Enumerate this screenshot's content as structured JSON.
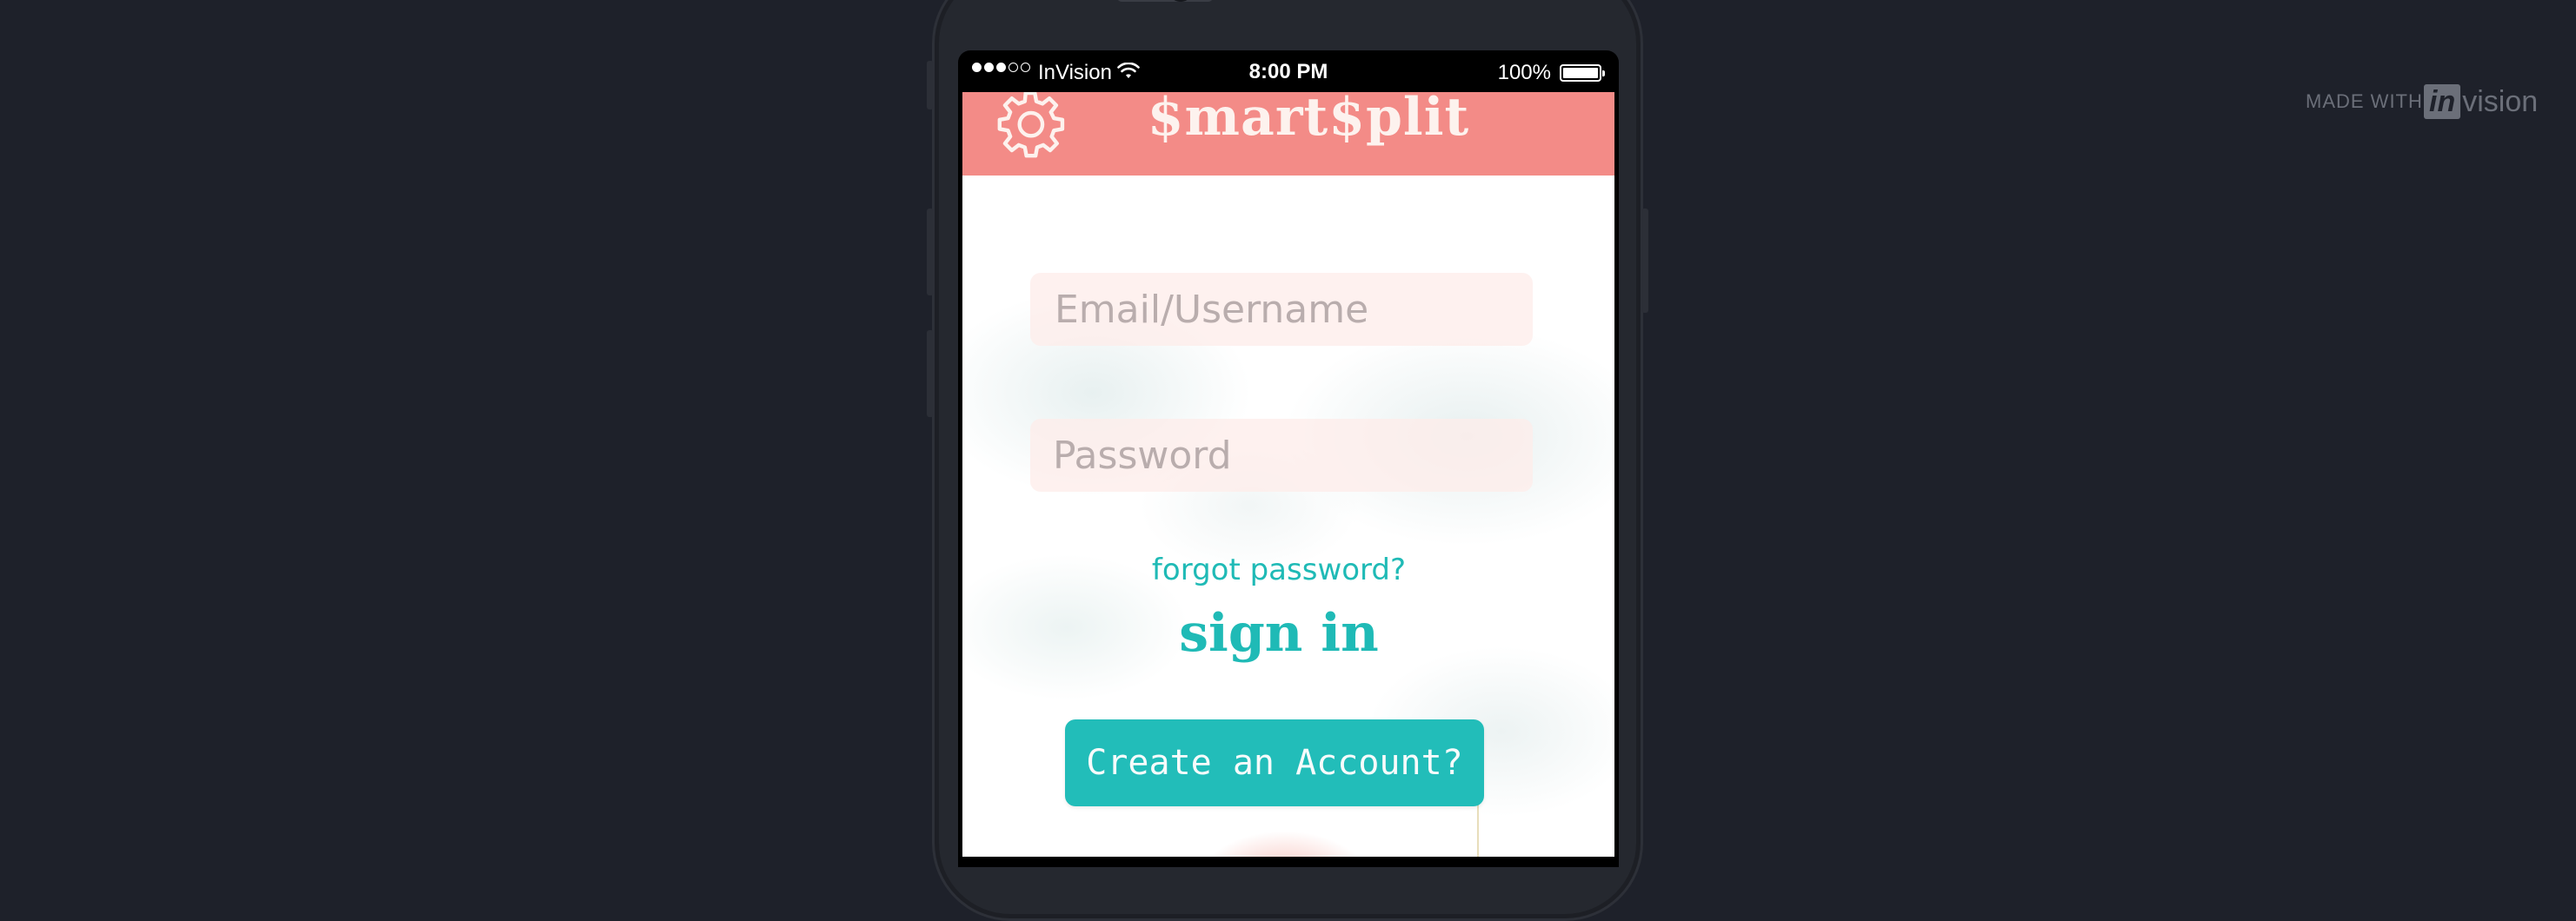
{
  "status_bar": {
    "carrier": "InVision",
    "time": "8:00 PM",
    "battery_pct": "100%",
    "signal_bars_filled": 3,
    "signal_bars_total": 5,
    "battery_level": 1.0
  },
  "app": {
    "title": "$mart$plit",
    "header_color": "#f38b87",
    "accent_color": "#1fbab6",
    "settings_icon": "gear-icon"
  },
  "login": {
    "email_placeholder": "Email/Username",
    "password_placeholder": "Password",
    "forgot_password": "forgot password?",
    "sign_in": "sign in",
    "create_account": "Create an Account?"
  },
  "watermark": {
    "made_with": "MADE WITH",
    "logo_in": "in",
    "logo_rest": "vision"
  }
}
